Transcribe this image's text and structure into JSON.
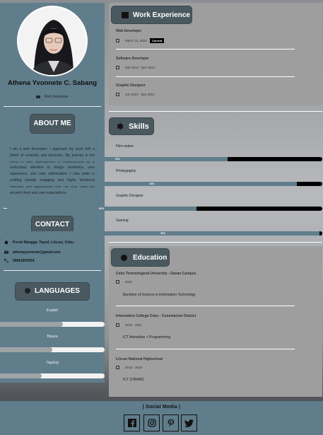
{
  "profile": {
    "name": "Athena Yvonnete C. Sabang",
    "role": "Web Developer"
  },
  "about": {
    "heading": "ABOUT ME",
    "text": "I am a web developer. I approach my work with a blend of creativity and precision. My journey in the world of web development is characterized by a meticulous attention to design aesthetics, user experience, and code optimization. I take pride in crafting visually engaging and highly functional websites and applications that not only meet but exceed client and user expectations."
  },
  "contact": {
    "heading": "CONTACT",
    "address": "Purok Mangga, Tayud, Lilo-an, Cebu",
    "email": "athenayvonnete@gmail.com",
    "phone": "09661843354"
  },
  "languages": {
    "heading": "LANGUAGES",
    "items": [
      {
        "label": "English",
        "level": 0.6
      },
      {
        "label": "Bisaya",
        "level": 0.5
      },
      {
        "label": "Tagalog",
        "level": 0.4
      }
    ]
  },
  "work": {
    "heading": "Work Experience",
    "jobs": [
      {
        "title": "Web Developer",
        "date": "March 11, 2023",
        "badge": "Current"
      },
      {
        "title": "Software Developer",
        "date": "Mar 2012 - Dec 2014",
        "badge": ""
      },
      {
        "title": "Graphic Designer",
        "date": "Jun 2010 - Mar 2012",
        "badge": ""
      }
    ]
  },
  "skills": {
    "heading": "Skills",
    "items": [
      {
        "name": "Film-maker",
        "percent": 70,
        "label": "70%"
      },
      {
        "name": "Photography",
        "percent": 92,
        "label": "92%"
      },
      {
        "name": "Graphic Designer",
        "percent": 60,
        "label": "60%"
      },
      {
        "name": "Gaming",
        "percent": 99,
        "label": "99%"
      }
    ]
  },
  "education": {
    "heading": "Education",
    "items": [
      {
        "school": "Cebu Technological University - Danao Campus",
        "year": "2023",
        "course": "Bachelor of Science in Information Technology"
      },
      {
        "school": "Informatics College Cebu - Consolacion District",
        "year": "2019 - 2021",
        "course": "ICT Animation + Programming"
      },
      {
        "school": "Lilo-an National Highschool",
        "year": "2015 - 2019",
        "course": "ICT STRAND"
      }
    ]
  },
  "footer": {
    "title": "| Social Media |",
    "links": [
      "facebook-icon",
      "instagram-icon",
      "pinterest-icon",
      "twitter-icon"
    ]
  },
  "colors": {
    "accent": "#607d8b",
    "pill": "#4a5960",
    "card": "#9e9e9e"
  }
}
